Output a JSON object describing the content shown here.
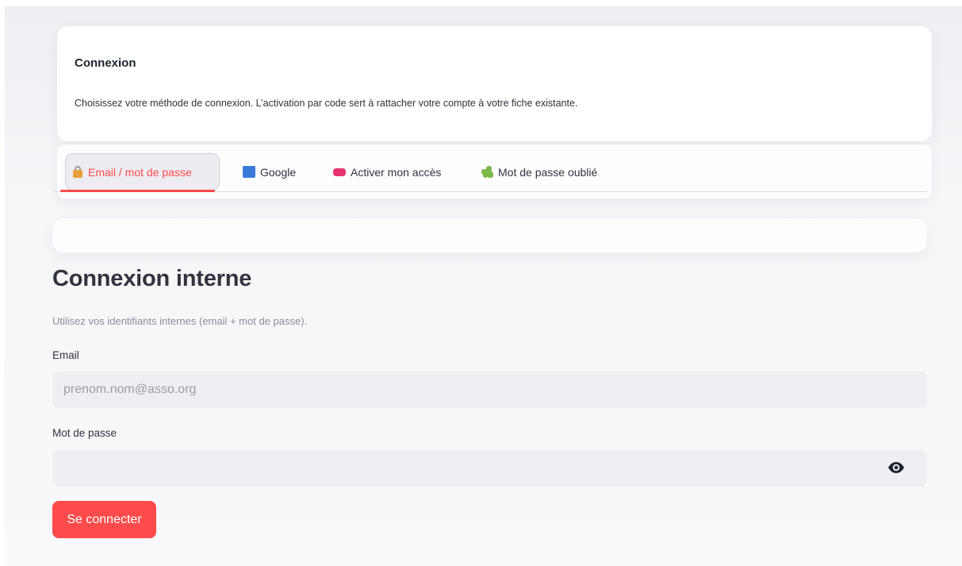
{
  "intro_card": {
    "title": "Connexion",
    "description": "Choisissez votre méthode de connexion. L’activation par code sert à rattacher votre compte à votre fiche existante."
  },
  "tabs": [
    {
      "label": "Email / mot de passe",
      "icon": "lock-icon",
      "active": true
    },
    {
      "label": "Google",
      "icon": "book-icon",
      "active": false
    },
    {
      "label": "Activer mon accès",
      "icon": "pill-icon",
      "active": false
    },
    {
      "label": "Mot de passe oublié",
      "icon": "puzzle-icon",
      "active": false
    }
  ],
  "section": {
    "title": "Connexion interne",
    "subtitle": "Utilisez vos identifiants internes (email + mot de passe)."
  },
  "form": {
    "email_label": "Email",
    "email_value": "",
    "email_placeholder": "prenom.nom@asso.org",
    "password_label": "Mot de passe",
    "password_value": "",
    "submit_label": "Se connecter"
  },
  "colors": {
    "accent": "#ff4b4b",
    "background": "#f6f6f9",
    "input_bg": "#efeff3",
    "text": "#31333f"
  }
}
